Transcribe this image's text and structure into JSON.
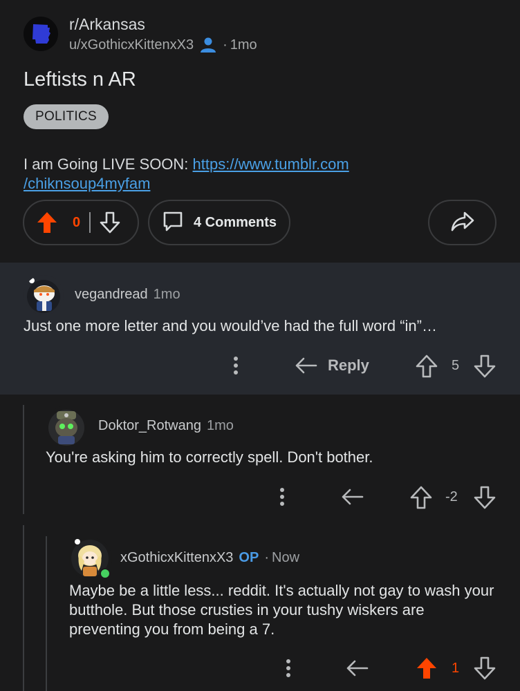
{
  "post": {
    "subreddit": "r/Arkansas",
    "author": "u/xGothicxKittenxX3",
    "age": "1mo",
    "title": "Leftists n AR",
    "flair": "POLITICS",
    "body_prefix": "I am Going LIVE SOON: ",
    "link_line1": "https://www.tumblr.com",
    "link_line2": "/chiknsoup4myfam",
    "vote_count": "0",
    "comments_label": "4 Comments",
    "accent": "#ff4500",
    "link_color": "#4aa0e6"
  },
  "comments": [
    {
      "author": "vegandread",
      "age": "1mo",
      "text": "Just one more letter and you would’ve had the full word “in”…",
      "reply_label": "Reply",
      "score": "5"
    },
    {
      "author": "Doktor_Rotwang",
      "age": "1mo",
      "text": "You're asking him to correctly spell. Don't bother.",
      "score": "-2"
    },
    {
      "author": "xGothicxKittenxX3",
      "op_badge": "OP",
      "age": "Now",
      "text": "Maybe be a little less... reddit. It's actually not gay to wash your butthole. But those crusties in your tushy wiskers are preventing you from being a 7.",
      "score": "1"
    }
  ]
}
